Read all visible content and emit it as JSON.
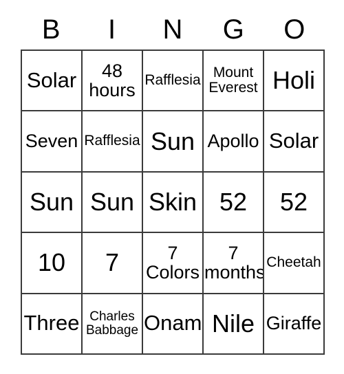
{
  "card": {
    "headers": [
      "B",
      "I",
      "N",
      "G",
      "O"
    ],
    "rows": [
      [
        {
          "text": "Solar",
          "size": "lg"
        },
        {
          "text": "48\nhours",
          "size": "md"
        },
        {
          "text": "Rafflesia",
          "size": "xs"
        },
        {
          "text": "Mount\nEverest",
          "size": "xs"
        },
        {
          "text": "Holi",
          "size": "xl"
        }
      ],
      [
        {
          "text": "Seven",
          "size": "md"
        },
        {
          "text": "Rafflesia",
          "size": "xs"
        },
        {
          "text": "Sun",
          "size": "xl"
        },
        {
          "text": "Apollo",
          "size": "md"
        },
        {
          "text": "Solar",
          "size": "lg"
        }
      ],
      [
        {
          "text": "Sun",
          "size": "xl"
        },
        {
          "text": "Sun",
          "size": "xl"
        },
        {
          "text": "Skin",
          "size": "xl"
        },
        {
          "text": "52",
          "size": "xl"
        },
        {
          "text": "52",
          "size": "xl"
        }
      ],
      [
        {
          "text": "10",
          "size": "xl"
        },
        {
          "text": "7",
          "size": "xl"
        },
        {
          "text": "7\nColors",
          "size": "md"
        },
        {
          "text": "7\nmonths",
          "size": "md"
        },
        {
          "text": "Cheetah",
          "size": "xs"
        }
      ],
      [
        {
          "text": "Three",
          "size": "lg"
        },
        {
          "text": "Charles\nBabbage",
          "size": "xxs"
        },
        {
          "text": "Onam",
          "size": "lg"
        },
        {
          "text": "Nile",
          "size": "xl"
        },
        {
          "text": "Giraffe",
          "size": "md"
        }
      ]
    ]
  },
  "colors": {
    "border": "#3a3a3a",
    "text": "#000000",
    "background": "#ffffff"
  }
}
